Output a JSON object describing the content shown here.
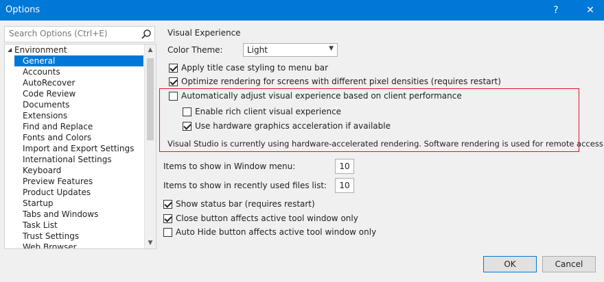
{
  "window": {
    "title": "Options",
    "help_glyph": "?",
    "close_glyph": "✕"
  },
  "search": {
    "placeholder": "Search Options (Ctrl+E)"
  },
  "tree": {
    "root": "Environment",
    "items": [
      "General",
      "Accounts",
      "AutoRecover",
      "Code Review",
      "Documents",
      "Extensions",
      "Find and Replace",
      "Fonts and Colors",
      "Import and Export Settings",
      "International Settings",
      "Keyboard",
      "Preview Features",
      "Product Updates",
      "Startup",
      "Tabs and Windows",
      "Task List",
      "Trust Settings",
      "Web Browser"
    ],
    "selected_index": 0
  },
  "visual": {
    "section_title": "Visual Experience",
    "color_theme_label": "Color Theme:",
    "color_theme_value": "Light",
    "opt_title_case": "Apply title case styling to menu bar",
    "opt_title_case_checked": true,
    "opt_pixel_density": "Optimize rendering for screens with different pixel densities (requires restart)",
    "opt_pixel_density_checked": true,
    "opt_auto_adjust": "Automatically adjust visual experience based on client performance",
    "opt_auto_adjust_checked": false,
    "opt_rich_client": "Enable rich client visual experience",
    "opt_rich_client_checked": false,
    "opt_hw_accel": "Use hardware graphics acceleration if available",
    "opt_hw_accel_checked": true,
    "status_text": "Visual Studio is currently using hardware-accelerated rendering. Software rendering is used for remote access."
  },
  "lists": {
    "window_menu_label": "Items to show in Window menu:",
    "window_menu_value": "10",
    "recent_files_label": "Items to show in recently used files list:",
    "recent_files_value": "10"
  },
  "misc": {
    "status_bar": "Show status bar (requires restart)",
    "status_bar_checked": true,
    "close_button": "Close button affects active tool window only",
    "close_button_checked": true,
    "auto_hide": "Auto Hide button affects active tool window only",
    "auto_hide_checked": false
  },
  "buttons": {
    "ok": "OK",
    "cancel": "Cancel"
  },
  "colors": {
    "accent": "#0078d7",
    "highlight_border": "#e81123"
  }
}
